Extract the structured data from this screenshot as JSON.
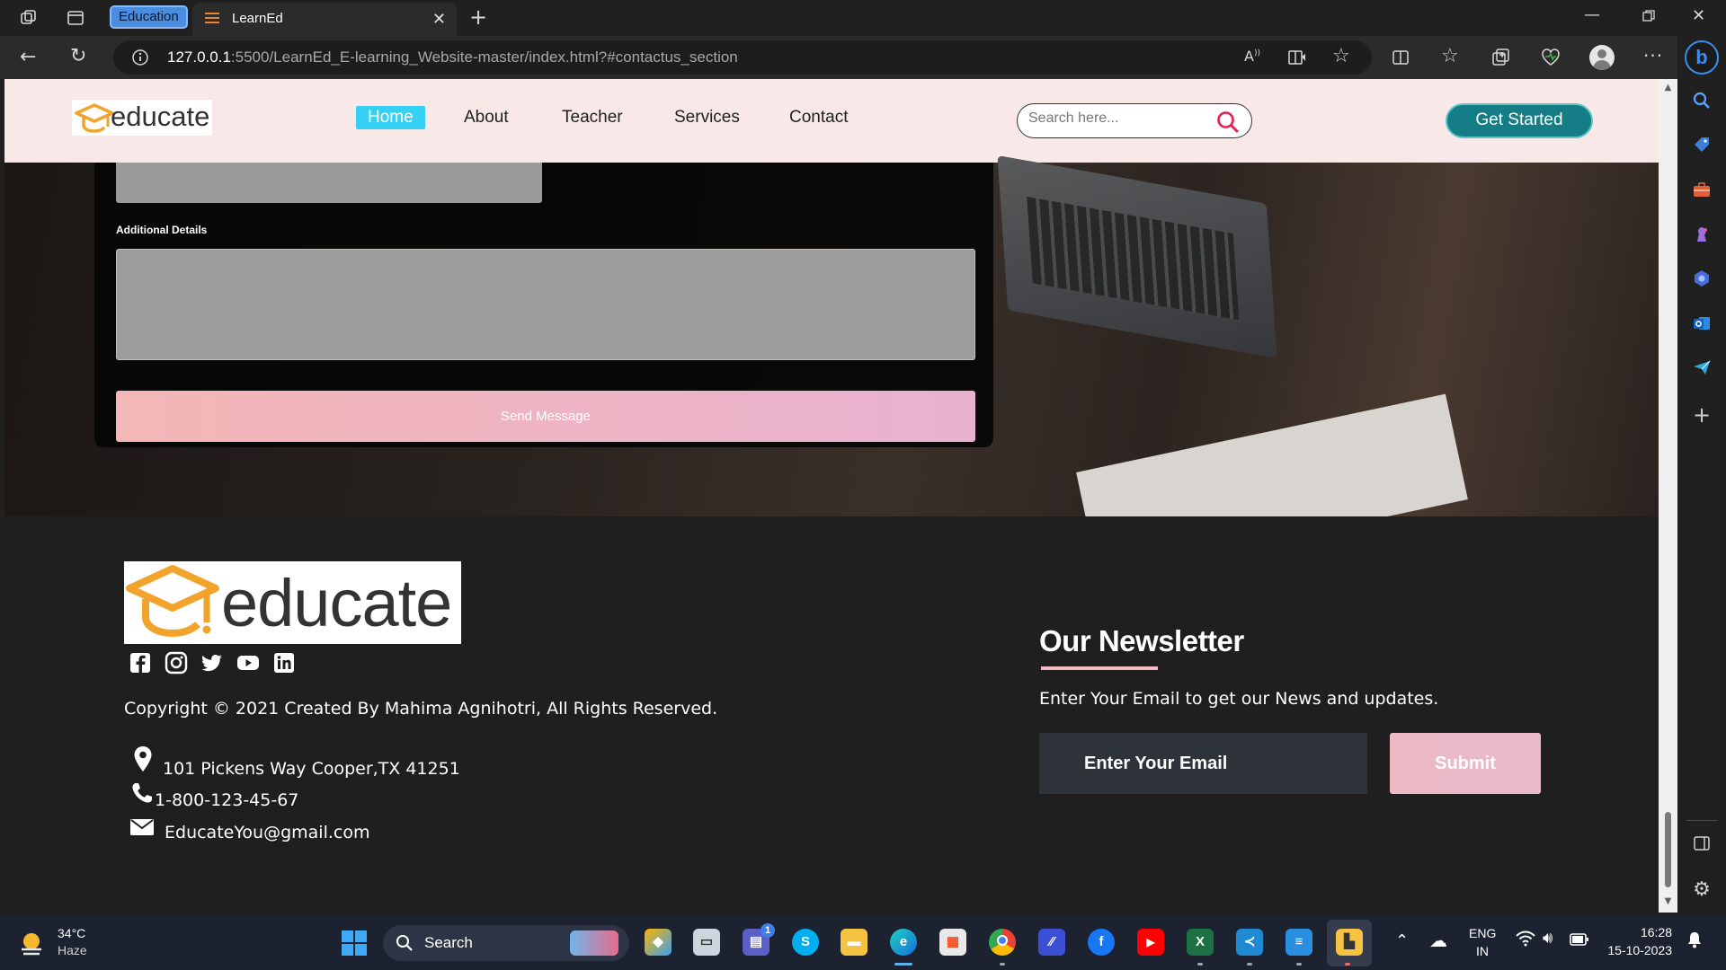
{
  "browser": {
    "tab_group_label": "Education",
    "tab_title": "LearnEd",
    "url_host": "127.0.0.1",
    "url_rest": ":5500/LearnEd_E-learning_Website-master/index.html?#contactus_section"
  },
  "site": {
    "logo_text": "educate",
    "nav": {
      "home": "Home",
      "about": "About",
      "teacher": "Teacher",
      "services": "Services",
      "contact": "Contact"
    },
    "search_placeholder": "Search here...",
    "get_started": "Get Started"
  },
  "contact_form": {
    "details_label": "Additional Details",
    "send_button": "Send Message"
  },
  "footer": {
    "logo_text": "educate",
    "copyright": "Copyright © 2021 Created By Mahima Agnihotri, All Rights Reserved.",
    "address": "101 Pickens Way Cooper,TX 41251",
    "phone": "1-800-123-45-67",
    "email": "EducateYou@gmail.com",
    "newsletter_title": "Our Newsletter",
    "newsletter_desc": "Enter Your Email to get our News and updates.",
    "email_placeholder": "Enter Your Email",
    "submit": "Submit",
    "social_icons": [
      "facebook-icon",
      "instagram-icon",
      "twitter-icon",
      "youtube-icon",
      "linkedin-icon"
    ]
  },
  "taskbar": {
    "weather_temp": "34°C",
    "weather_desc": "Haze",
    "search_label": "Search",
    "lang_line1": "ENG",
    "lang_line2": "IN",
    "time": "16:28",
    "date": "15-10-2023",
    "teams_badge": "1"
  },
  "colors": {
    "accent_teal": "#157d85",
    "nav_home": "#34d1f2",
    "header_bg": "#f8e8e7",
    "pink_button": "#f4b6b6",
    "logo_orange": "#f2a32b"
  }
}
